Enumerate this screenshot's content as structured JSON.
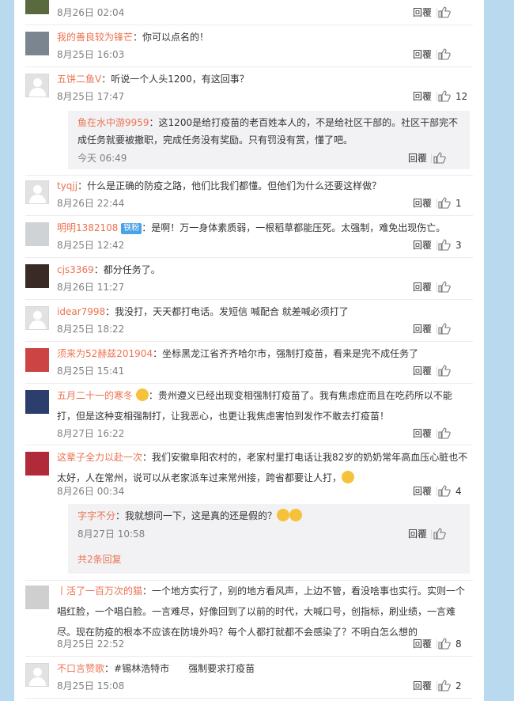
{
  "reply_label": "回覆",
  "comments": [
    {
      "time": "8月26日 02:04",
      "likes": ""
    },
    {
      "user": "我的善良较为锋芒",
      "content": "：你可以点名的！",
      "time": "8月25日 16:03",
      "likes": ""
    },
    {
      "user": "五饼二鱼V",
      "content": "：听说一个人头1200，有这回事？",
      "time": "8月25日 17:47",
      "likes": "12",
      "reply": {
        "user": "鱼在水中游9959",
        "content": "：这1200是给打疫苗的老百姓本人的，不是给社区干部的。社区干部完不成任务就要被撤职，完成任务没有奖励。只有罚没有赏，懂了吧。",
        "time": "今天 06:49",
        "likes": ""
      }
    },
    {
      "user": "tyqjj",
      "content": "：什么是正确的防疫之路，他们比我们都懂。但他们为什么还要这样做？",
      "time": "8月26日 22:44",
      "likes": "1"
    },
    {
      "user": "明明1382108",
      "badge": "铁粉",
      "content": "：是啊！万一身体素质弱，一根稻草都能压死。太强制，难免出现伤亡。",
      "time": "8月25日 12:42",
      "likes": "3"
    },
    {
      "user": "cjs3369",
      "content": "：都分任务了。",
      "time": "8月26日 11:27",
      "likes": ""
    },
    {
      "user": "idear7998",
      "content": "：我没打，天天都打电话。发短信 喊配合 就差喊必须打了",
      "time": "8月25日 18:22",
      "likes": ""
    },
    {
      "user": "须来为52赫兹201904",
      "content": "：坐标黑龙江省齐齐哈尔市，强制打疫苗，看来是完不成任务了",
      "time": "8月25日 15:41",
      "likes": ""
    },
    {
      "user": "五月二十一的寒冬",
      "content": "：贵州遵义已经出现变相强制打疫苗了。我有焦虑症而且在吃药所以不能打，但是这种变相强制打，让我恶心，也更让我焦虑害怕到发作不敢去打疫苗！",
      "time": "8月27日 16:22",
      "likes": ""
    },
    {
      "user": "这辈子全力以赴一次",
      "content": "：我们安徽阜阳农村的，老家村里打电话让我82岁的奶奶常年高血压心脏也不太好，人在常州，说可以从老家派车过来常州接，跨省都要让人打，",
      "time": "8月26日 00:34",
      "likes": "4",
      "reply": {
        "user": "字字不分",
        "content": "：我就想问一下，这是真的还是假的？",
        "time": "8月27日 10:58",
        "likes": "",
        "more": "共2条回复"
      }
    },
    {
      "user": "丨活了一百万次的猫",
      "content": "：一个地方实行了，别的地方看风声，上边不管，看没啥事也实行。实则一个唱红脸，一个唱白脸。一言难尽，好像回到了以前的时代，大喊口号，创指标，刷业绩，一言难尽。现在防疫的根本不应该在防境外吗？每个人都打就都不会感染了？不明白怎么想的",
      "time": "8月25日 22:52",
      "likes": "8"
    },
    {
      "user": "不口言赞歌",
      "content": "：#锡林浩特市　　强制要求打疫苗",
      "time": "8月25日 15:08",
      "likes": "2"
    }
  ]
}
